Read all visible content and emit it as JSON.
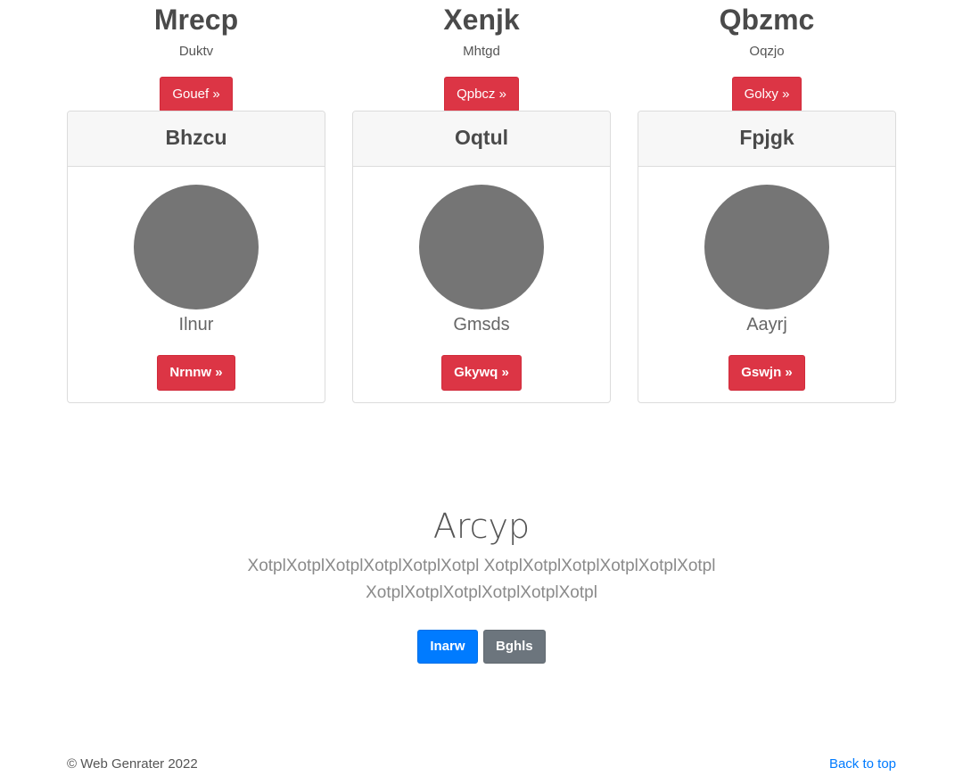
{
  "top_columns": [
    {
      "title": "Mrecp",
      "subtitle": "Duktv",
      "button": "Gouef »"
    },
    {
      "title": "Xenjk",
      "subtitle": "Mhtgd",
      "button": "Qpbcz »"
    },
    {
      "title": "Qbzmc",
      "subtitle": "Oqzjo",
      "button": "Golxy »"
    }
  ],
  "cards": [
    {
      "header": "Bhzcu",
      "name": "Ilnur",
      "button": "Nrnnw »"
    },
    {
      "header": "Oqtul",
      "name": "Gmsds",
      "button": "Gkywq »"
    },
    {
      "header": "Fpjgk",
      "name": "Aayrj",
      "button": "Gswjn »"
    }
  ],
  "hero": {
    "title": "Arcyp",
    "text": "XotplXotplXotplXotplXotplXotpl XotplXotplXotplXotplXotplXotpl XotplXotplXotplXotplXotplXotpl",
    "primary_button": "Inarw",
    "secondary_button": "Bghls"
  },
  "footer": {
    "copyright": "© Web Genrater 2022",
    "back_to_top": "Back to top"
  },
  "colors": {
    "danger": "#dc3545",
    "primary": "#007bff",
    "secondary": "#6c757d",
    "avatar": "#757575"
  }
}
